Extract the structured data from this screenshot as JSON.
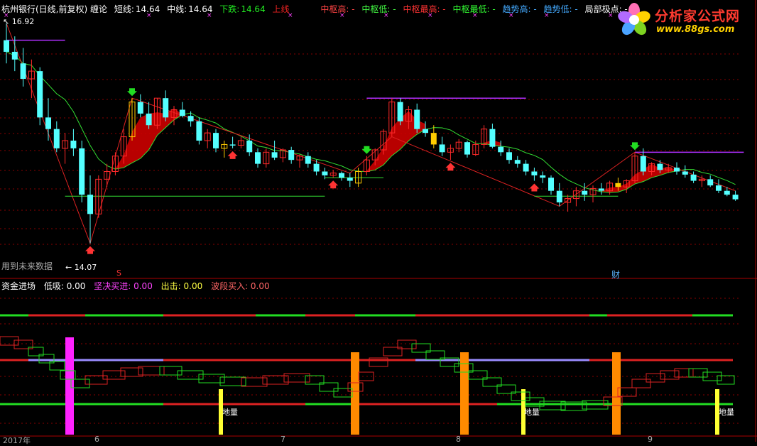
{
  "header": {
    "title": "杭州银行(日线,前复权) 缠论",
    "short_label": "短线:",
    "short_value": "14.64",
    "mid_label": "中线:",
    "mid_value": "14.64",
    "down_label": "下跌:",
    "down_value": "14.64",
    "up_label": "上线",
    "zs_high": "中枢高: -",
    "zs_low": "中枢低: -",
    "zs_max": "中枢最高: -",
    "zs_min": "中枢最低: -",
    "trend_high": "趋势高: -",
    "trend_low": "趋势低: -",
    "local_extreme": "局部极点: -",
    "colors": {
      "title": "#ffffff",
      "short": "#ffffff",
      "mid": "#ffffff",
      "down": "#22ee22",
      "up": "#ee2222",
      "zs_high": "#ff4444",
      "zs_low": "#44ff44",
      "zs_max": "#ff3333",
      "zs_min": "#33ff33",
      "trend_high": "#44aaff",
      "trend_low": "#44aaff",
      "local_extreme": "#ffffff"
    }
  },
  "price_chart": {
    "high_label": "16.92",
    "low_label": "14.07",
    "future_note": "用到未来数据",
    "wealth_marker": "财",
    "s_marker": "S"
  },
  "indicator": {
    "fund_in": "资金进场",
    "low_buy": "低吸: 0.00",
    "firm_buy": "坚决买进: 0.00",
    "exit": "出击: 0.00",
    "wave_buy": "波段买入: 0.00",
    "land_label": "地量"
  },
  "x_axis": {
    "year_label": "2017年",
    "month_labels": [
      "6",
      "7",
      "8",
      "9"
    ]
  },
  "logo": {
    "title": "分析家公式网",
    "url": "www.88gs.com"
  },
  "chart_data": {
    "type": "candlestick",
    "title": "杭州银行(日线,前复权)",
    "ylim": [
      13.8,
      17.0
    ],
    "candles": [
      [
        16.7,
        16.92,
        16.4,
        16.55
      ],
      [
        16.55,
        16.75,
        16.3,
        16.45
      ],
      [
        16.4,
        16.6,
        16.1,
        16.2
      ],
      [
        16.2,
        16.45,
        15.95,
        16.3
      ],
      [
        16.3,
        16.35,
        15.6,
        15.7
      ],
      [
        15.7,
        15.95,
        15.4,
        15.55
      ],
      [
        15.55,
        15.65,
        15.25,
        15.3
      ],
      [
        15.3,
        15.5,
        15.1,
        15.4
      ],
      [
        15.4,
        15.55,
        15.2,
        15.3
      ],
      [
        15.3,
        15.4,
        14.6,
        14.7
      ],
      [
        14.7,
        14.95,
        14.07,
        14.45
      ],
      [
        14.45,
        14.95,
        14.4,
        14.9
      ],
      [
        14.9,
        15.1,
        14.8,
        15.0
      ],
      [
        15.0,
        15.25,
        14.95,
        15.2
      ],
      [
        15.2,
        15.55,
        15.1,
        15.45
      ],
      [
        15.45,
        15.95,
        15.4,
        15.9
      ],
      [
        15.9,
        16.0,
        15.7,
        15.75
      ],
      [
        15.75,
        15.9,
        15.55,
        15.6
      ],
      [
        15.6,
        15.95,
        15.55,
        15.95
      ],
      [
        15.95,
        16.05,
        15.65,
        15.7
      ],
      [
        15.7,
        15.85,
        15.6,
        15.8
      ],
      [
        15.8,
        15.9,
        15.7,
        15.72
      ],
      [
        15.72,
        15.78,
        15.58,
        15.65
      ],
      [
        15.65,
        15.7,
        15.35,
        15.4
      ],
      [
        15.4,
        15.55,
        15.3,
        15.5
      ],
      [
        15.5,
        15.55,
        15.25,
        15.3
      ],
      [
        15.3,
        15.4,
        15.18,
        15.35
      ],
      [
        15.35,
        15.45,
        15.3,
        15.34
      ],
      [
        15.34,
        15.45,
        15.3,
        15.4
      ],
      [
        15.4,
        15.48,
        15.2,
        15.25
      ],
      [
        15.25,
        15.3,
        15.05,
        15.1
      ],
      [
        15.1,
        15.3,
        15.05,
        15.25
      ],
      [
        15.25,
        15.4,
        15.15,
        15.18
      ],
      [
        15.18,
        15.3,
        15.12,
        15.28
      ],
      [
        15.28,
        15.32,
        15.1,
        15.15
      ],
      [
        15.15,
        15.22,
        15.05,
        15.2
      ],
      [
        15.2,
        15.25,
        15.05,
        15.1
      ],
      [
        15.1,
        15.15,
        14.95,
        15.0
      ],
      [
        15.0,
        15.05,
        14.9,
        14.95
      ],
      [
        14.95,
        15.02,
        14.92,
        14.98
      ],
      [
        14.98,
        15.0,
        14.88,
        14.92
      ],
      [
        14.92,
        14.98,
        14.8,
        14.88
      ],
      [
        14.85,
        15.05,
        14.8,
        15.0
      ],
      [
        15.0,
        15.2,
        14.95,
        15.15
      ],
      [
        15.15,
        15.3,
        15.08,
        15.28
      ],
      [
        15.28,
        15.55,
        15.22,
        15.52
      ],
      [
        15.5,
        15.95,
        15.45,
        15.9
      ],
      [
        15.9,
        15.95,
        15.6,
        15.65
      ],
      [
        15.65,
        15.85,
        15.55,
        15.8
      ],
      [
        15.8,
        15.88,
        15.5,
        15.55
      ],
      [
        15.55,
        15.65,
        15.45,
        15.5
      ],
      [
        15.5,
        15.6,
        15.3,
        15.35
      ],
      [
        15.35,
        15.45,
        15.2,
        15.25
      ],
      [
        15.25,
        15.35,
        15.15,
        15.3
      ],
      [
        15.3,
        15.42,
        15.25,
        15.38
      ],
      [
        15.38,
        15.4,
        15.18,
        15.22
      ],
      [
        15.22,
        15.4,
        15.2,
        15.35
      ],
      [
        15.35,
        15.6,
        15.3,
        15.55
      ],
      [
        15.55,
        15.62,
        15.3,
        15.32
      ],
      [
        15.32,
        15.4,
        15.2,
        15.25
      ],
      [
        15.25,
        15.3,
        15.1,
        15.15
      ],
      [
        15.15,
        15.2,
        15.05,
        15.1
      ],
      [
        15.1,
        15.15,
        14.95,
        15.0
      ],
      [
        15.0,
        15.05,
        14.88,
        14.95
      ],
      [
        14.95,
        15.0,
        14.85,
        14.92
      ],
      [
        14.92,
        14.95,
        14.7,
        14.75
      ],
      [
        14.75,
        14.85,
        14.55,
        14.6
      ],
      [
        14.6,
        14.7,
        14.48,
        14.65
      ],
      [
        14.65,
        14.8,
        14.55,
        14.75
      ],
      [
        14.75,
        14.85,
        14.62,
        14.7
      ],
      [
        14.7,
        14.82,
        14.6,
        14.78
      ],
      [
        14.78,
        14.85,
        14.7,
        14.75
      ],
      [
        14.75,
        14.88,
        14.7,
        14.85
      ],
      [
        14.85,
        14.92,
        14.75,
        14.8
      ],
      [
        14.8,
        14.9,
        14.72,
        14.88
      ],
      [
        14.88,
        15.25,
        14.85,
        15.2
      ],
      [
        15.2,
        15.3,
        14.95,
        15.0
      ],
      [
        15.0,
        15.12,
        14.95,
        15.1
      ],
      [
        15.1,
        15.15,
        14.98,
        15.02
      ],
      [
        15.02,
        15.1,
        14.98,
        15.05
      ],
      [
        15.05,
        15.12,
        14.96,
        15.0
      ],
      [
        15.0,
        15.08,
        14.92,
        14.96
      ],
      [
        14.96,
        15.0,
        14.85,
        14.88
      ],
      [
        14.88,
        14.95,
        14.8,
        14.9
      ],
      [
        14.9,
        14.95,
        14.8,
        14.82
      ],
      [
        14.82,
        14.9,
        14.72,
        14.75
      ],
      [
        14.75,
        14.8,
        14.68,
        14.7
      ],
      [
        14.7,
        14.75,
        14.62,
        14.64
      ]
    ]
  }
}
